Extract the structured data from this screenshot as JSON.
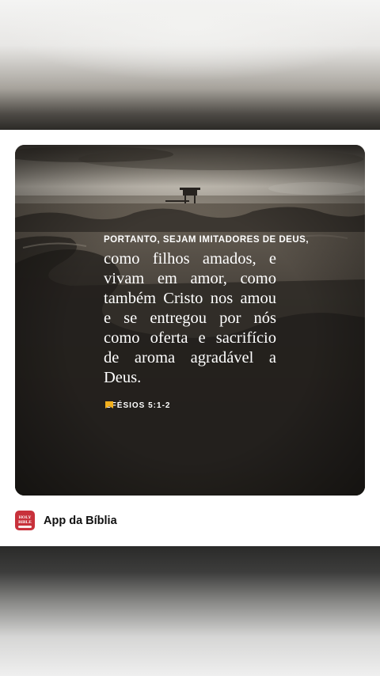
{
  "verse": {
    "lead": "PORTANTO, SEJAM IMITADORES DE DEUS,",
    "body": "como filhos amados, e vivam em amor, como também Cristo nos amou e se entregou por nós como oferta e sacrifício de aroma agradável a Deus.",
    "reference": "EFÉSIOS 5:1-2"
  },
  "app": {
    "name": "App da Bíblia",
    "icon_label_line1": "HOLY",
    "icon_label_line2": "BIBLE"
  },
  "colors": {
    "app_icon": "#c8313b",
    "reference_icon": "#f2b01e",
    "verse_text": "#ffffff"
  }
}
